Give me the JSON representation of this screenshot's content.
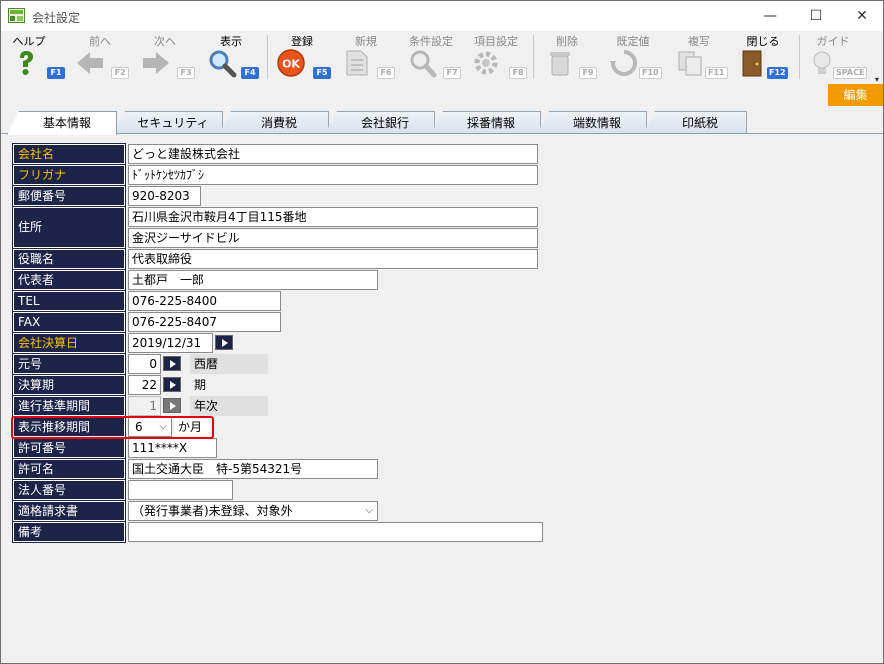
{
  "window": {
    "title": "会社設定",
    "minimize": "—",
    "maximize": "☐",
    "close": "✕"
  },
  "toolbar": {
    "buttons": [
      {
        "label": "ヘルプ",
        "fkey": "F1",
        "icon": "help-icon",
        "enabled": true
      },
      {
        "label": "前へ",
        "fkey": "F2",
        "icon": "arrow-left-icon",
        "enabled": false
      },
      {
        "label": "次へ",
        "fkey": "F3",
        "icon": "arrow-right-icon",
        "enabled": false
      },
      {
        "label": "表示",
        "fkey": "F4",
        "icon": "magnifier-icon",
        "enabled": true
      },
      {
        "label": "登録",
        "fkey": "F5",
        "icon": "ok-icon",
        "enabled": true
      },
      {
        "label": "新規",
        "fkey": "F6",
        "icon": "new-document-icon",
        "enabled": false
      },
      {
        "label": "条件設定",
        "fkey": "F7",
        "icon": "condition-search-icon",
        "enabled": false
      },
      {
        "label": "項目設定",
        "fkey": "F8",
        "icon": "item-settings-icon",
        "enabled": false
      },
      {
        "label": "削除",
        "fkey": "F9",
        "icon": "trash-icon",
        "enabled": false
      },
      {
        "label": "既定値",
        "fkey": "F10",
        "icon": "reset-icon",
        "enabled": false
      },
      {
        "label": "複写",
        "fkey": "F11",
        "icon": "copy-icon",
        "enabled": false
      },
      {
        "label": "閉じる",
        "fkey": "F12",
        "icon": "close-door-icon",
        "enabled": true
      },
      {
        "label": "ガイド",
        "fkey": "SPACE",
        "icon": "lightbulb-icon",
        "enabled": false
      }
    ],
    "scroll_arrow": "▾"
  },
  "edit_button": "編集",
  "tabs": [
    "基本情報",
    "セキュリティ",
    "消費税",
    "会社銀行",
    "採番情報",
    "端数情報",
    "印紙税"
  ],
  "active_tab": "基本情報",
  "form": {
    "company_name": {
      "label": "会社名",
      "value": "どっと建設株式会社"
    },
    "furigana": {
      "label": "フリガナ",
      "value": "ﾄﾞｯﾄｹﾝｾﾂｶﾌﾞｼ"
    },
    "postal": {
      "label": "郵便番号",
      "value": "920-8203"
    },
    "address": {
      "label": "住所",
      "line1": "石川県金沢市鞍月4丁目115番地",
      "line2": "金沢ジーサイドビル"
    },
    "title": {
      "label": "役職名",
      "value": "代表取締役"
    },
    "representative": {
      "label": "代表者",
      "value": "土都戸　一郎"
    },
    "tel": {
      "label": "TEL",
      "value": "076-225-8400"
    },
    "fax": {
      "label": "FAX",
      "value": "076-225-8407"
    },
    "fiscal_date": {
      "label": "会社決算日",
      "value": "2019/12/31"
    },
    "era": {
      "label": "元号",
      "value": "0",
      "text": "西暦"
    },
    "fiscal_period": {
      "label": "決算期",
      "value": "22",
      "text": "期"
    },
    "progress_period": {
      "label": "進行基準期間",
      "value": "1",
      "text": "年次"
    },
    "display_period": {
      "label": "表示推移期間",
      "value": "6",
      "text": "か月"
    },
    "license_no": {
      "label": "許可番号",
      "value": "111****X"
    },
    "license_name": {
      "label": "許可名",
      "value": "国土交通大臣　特-5第54321号"
    },
    "corporate_no": {
      "label": "法人番号",
      "value": ""
    },
    "invoice": {
      "label": "適格請求書",
      "value": "（発行事業者)未登録、対象外"
    },
    "remarks": {
      "label": "備考",
      "value": ""
    }
  }
}
